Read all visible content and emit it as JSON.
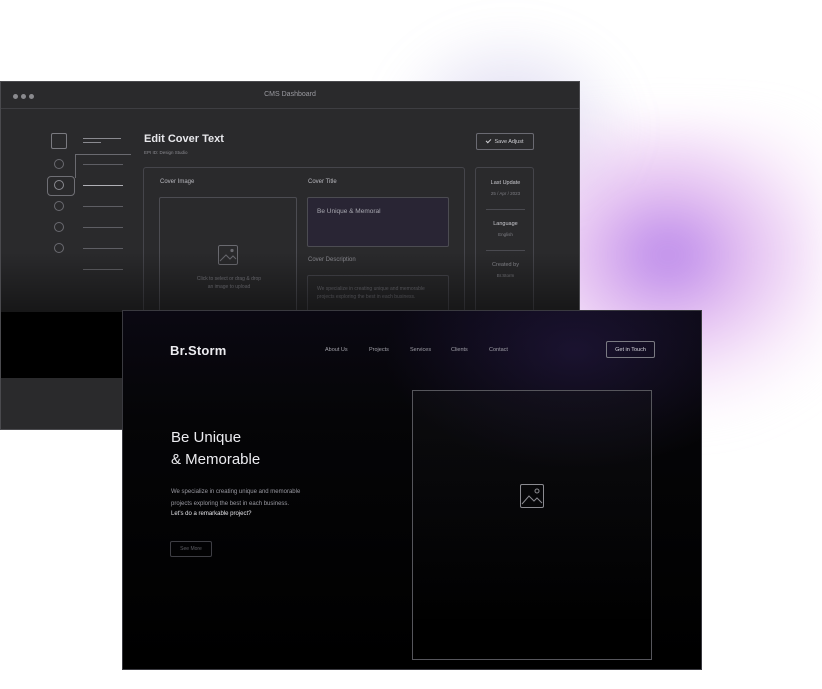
{
  "cms": {
    "window_title": "CMS Dashboard",
    "heading": "Edit Cover Text",
    "subheading": "EPI ID: Design Studio",
    "save_button": "Save Adjust",
    "fields": {
      "cover_image_label": "Cover Image",
      "cover_image_hint_1": "Click to select or drag & drop",
      "cover_image_hint_2": "an image to upload",
      "cover_title_label": "Cover Title",
      "cover_title_value": "Be Unique & Memoral",
      "cover_description_label": "Cover Description",
      "cover_description_value_1": "We specialize in creating unique and memorable",
      "cover_description_value_2": "projects exploring the best in each business."
    },
    "meta": {
      "last_update_label": "Last Update",
      "last_update_value": "25 / Apr / 2023",
      "language_label": "Language",
      "language_value": "English",
      "created_by_label": "Created by",
      "created_by_value": "Br.Storm"
    }
  },
  "site": {
    "logo": "Br.Storm",
    "nav": [
      "About Us",
      "Projects",
      "Services",
      "Clients",
      "Contact"
    ],
    "cta": "Get in Touch",
    "hero": {
      "title_line1": "Be Unique",
      "title_line2": "& Memorable",
      "text_line1": "We specialize in creating unique and memorable",
      "text_line2": "projects exploring the best in each business.",
      "cta_text": "Let's do a remarkable project?",
      "button": "See More"
    }
  },
  "icons": [
    "image-placeholder-icon",
    "checkmark-icon"
  ]
}
